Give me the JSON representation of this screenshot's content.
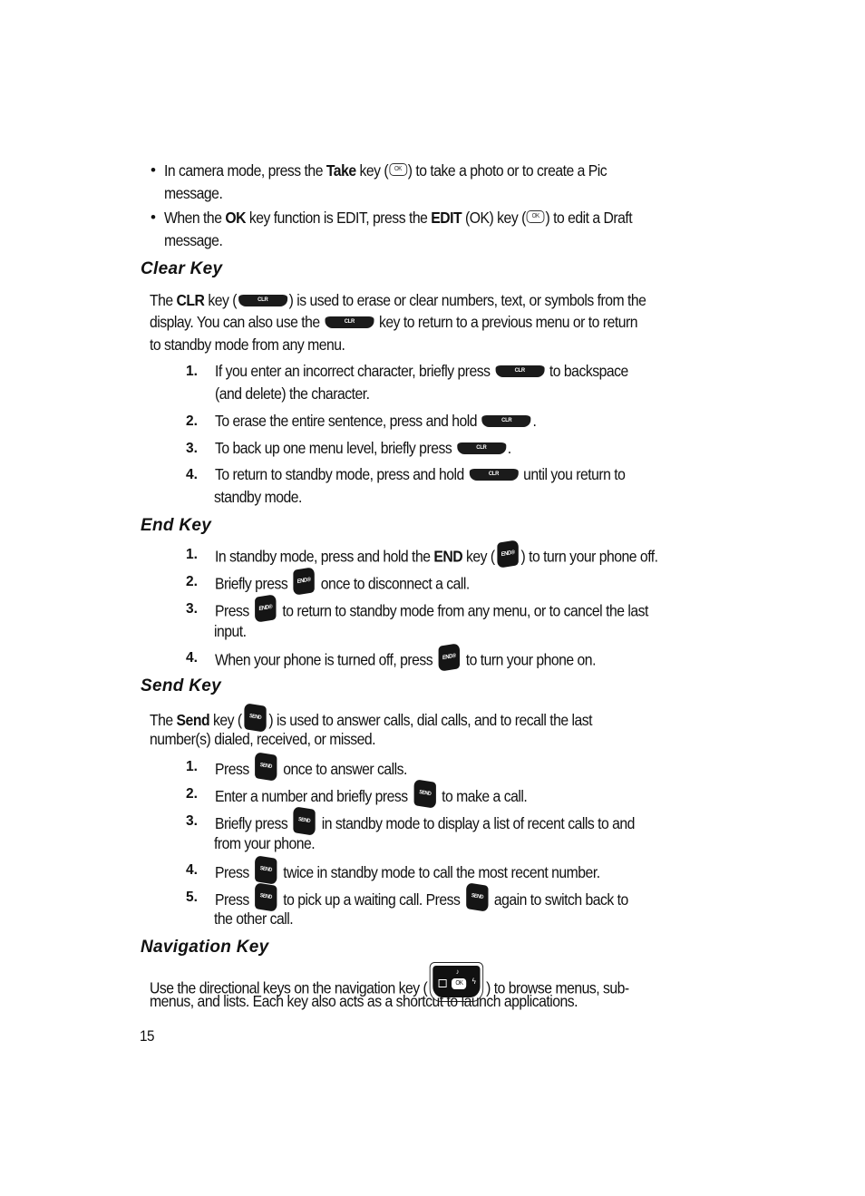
{
  "bullets": [
    {
      "line1": {
        "a": "In camera mode, press the ",
        "b": "Take",
        "c": " key (",
        "d": ") to take a photo or to create a Pic"
      },
      "line2": "message."
    },
    {
      "line1": {
        "a": "When the ",
        "b": "OK",
        "c": " key function is EDIT, press the ",
        "d": "EDIT",
        "e": " (OK) key (",
        "f": ") to edit a Draft"
      },
      "line2": "message."
    }
  ],
  "sections": {
    "clear": {
      "heading": "Clear Key",
      "intro": {
        "l1": {
          "a": "The ",
          "b": "CLR",
          "c": " key (",
          "d": ") is used to erase or clear numbers, text, or symbols from the"
        },
        "l2": {
          "a": "display. You can also use the ",
          "b": " key to return to a previous menu or to return"
        },
        "l3": "to standby mode from any menu."
      },
      "steps": [
        {
          "num": "1.",
          "a": "If you enter an incorrect character, briefly press ",
          "b": " to backspace",
          "cont": "(and delete) the character."
        },
        {
          "num": "2.",
          "a": "To erase the entire sentence, press and hold ",
          "b": "."
        },
        {
          "num": "3.",
          "a": "To back up one menu level, briefly press ",
          "b": "."
        },
        {
          "num": "4.",
          "a": "To return to standby mode, press and hold ",
          "b": " until you return to",
          "cont": "standby mode."
        }
      ]
    },
    "end": {
      "heading": "End Key",
      "steps": [
        {
          "num": "1.",
          "a": "In standby mode, press and hold the ",
          "bold": "END",
          "a2": " key (",
          "b": ") to turn your phone off."
        },
        {
          "num": "2.",
          "a": "Briefly press ",
          "b": " once to disconnect a call."
        },
        {
          "num": "3.",
          "a": "Press ",
          "b": " to return to standby mode from any menu, or to cancel the last",
          "cont": "input."
        },
        {
          "num": "4.",
          "a": "When your phone is turned off, press ",
          "b": " to turn your phone on."
        }
      ]
    },
    "send": {
      "heading": "Send Key",
      "intro": {
        "l1": {
          "a": "The ",
          "b": "Send",
          "c": " key (",
          "d": ") is used to answer calls, dial calls, and to recall the last"
        },
        "l2": "number(s) dialed, received, or missed."
      },
      "steps": [
        {
          "num": "1.",
          "a": "Press ",
          "b": " once to answer calls."
        },
        {
          "num": "2.",
          "a": "Enter a number and briefly press ",
          "b": " to make a call."
        },
        {
          "num": "3.",
          "a": "Briefly press ",
          "b": " in standby mode to display a list of recent calls to and",
          "cont": "from your phone."
        },
        {
          "num": "4.",
          "a": "Press ",
          "b": " twice in standby mode to call the most recent number."
        },
        {
          "num": "5.",
          "a": "Press ",
          "b": " to pick up a waiting call. Press ",
          "c": " again to switch back to",
          "cont": "the other call."
        }
      ]
    },
    "navigation": {
      "heading": "Navigation Key",
      "intro": {
        "l1": {
          "a": "Use the directional keys on the navigation key (",
          "b": ") to browse menus, sub-"
        },
        "l2": "menus, and lists. Each key also acts as a shortcut to launch applications."
      },
      "nav_icon_center": "OK"
    }
  },
  "icons": {
    "ok": "ok-key-icon",
    "clr": "clr-key-icon",
    "end": "end-key-icon",
    "send": "send-key-icon",
    "nav": "navigation-key-icon"
  },
  "page_number": "15"
}
